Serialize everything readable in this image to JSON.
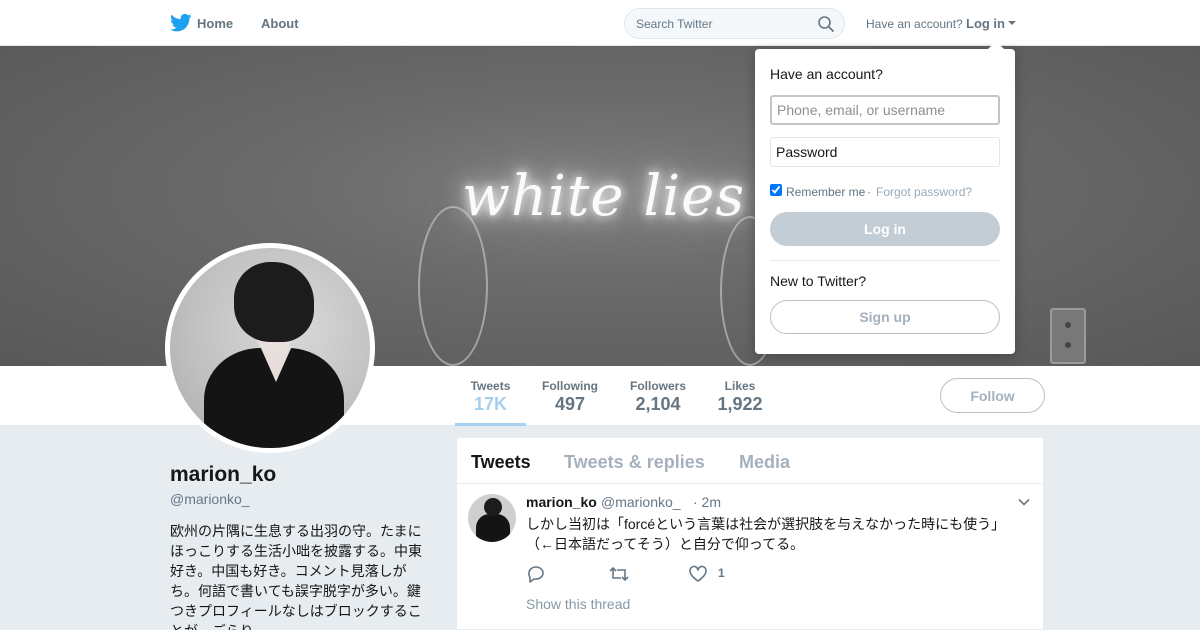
{
  "nav": {
    "home_label": "Home",
    "about_label": "About",
    "search_placeholder": "Search Twitter",
    "have_account_text": "Have an account?",
    "login_label": "Log in",
    "brand_color": "#1da1f2"
  },
  "banner": {
    "neon_text": "white lies"
  },
  "profile": {
    "name": "marion_ko",
    "handle": "@marionko_",
    "bio": "欧州の片隅に生息する出羽の守。たまにほっこりする生活小咄を披露する。中東好き。中国も好き。コメント見落しがち。何語で書いても誤字脱字が多い。鍵つきプロフィールなしはブロックすることが、ごらり"
  },
  "stats": [
    {
      "label": "Tweets",
      "value": "17K"
    },
    {
      "label": "Following",
      "value": "497"
    },
    {
      "label": "Followers",
      "value": "2,104"
    },
    {
      "label": "Likes",
      "value": "1,922"
    }
  ],
  "follow_label": "Follow",
  "tabs": [
    "Tweets",
    "Tweets & replies",
    "Media"
  ],
  "tweet": {
    "name": "marion_ko",
    "handle": "@marionko_",
    "time": "· 2m",
    "text": "しかし当初は「forcéという言葉は社会が選択肢を与えなかった時にも使う」（←日本語だってそう）と自分で仰ってる。",
    "like_count": "1",
    "show_thread": "Show this thread"
  },
  "login_dropdown": {
    "title": "Have an account?",
    "username_placeholder": "Phone, email, or username",
    "password_placeholder": "Password",
    "remember_me": "Remember me",
    "separator": "·",
    "forgot_password": "Forgot password?",
    "login_button": "Log in",
    "new_to_twitter": "New to Twitter?",
    "signup_button": "Sign up"
  }
}
